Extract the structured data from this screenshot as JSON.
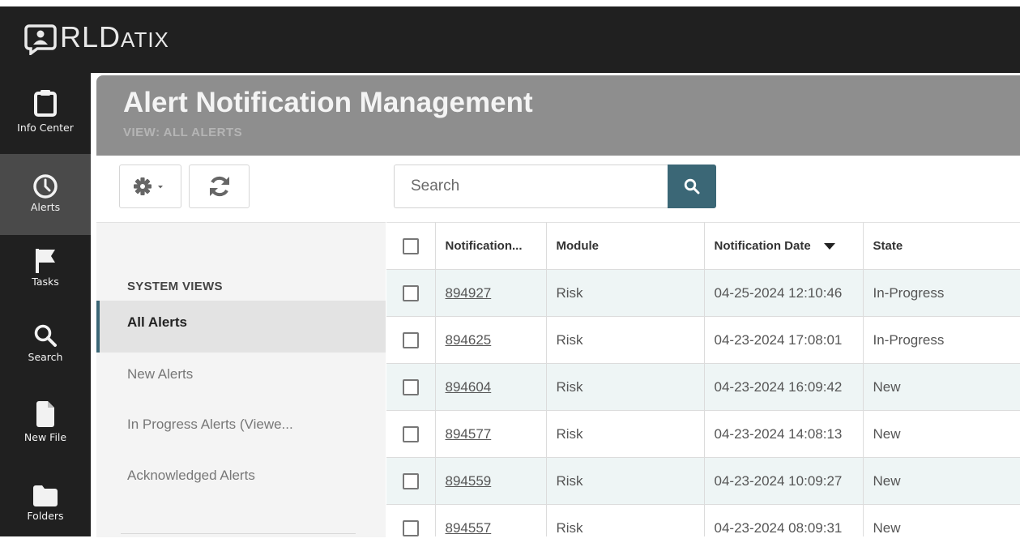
{
  "brand": {
    "logo_text_r": "R",
    "logo_text_l": "L",
    "logo_text_d": "D",
    "logo_text_rest": "ATIX",
    "logo_icon": "chat-person-icon"
  },
  "sidebar": {
    "items": [
      {
        "label": "Info Center",
        "icon": "clipboard-icon",
        "active": false
      },
      {
        "label": "Alerts",
        "icon": "clock-icon",
        "active": true
      },
      {
        "label": "Tasks",
        "icon": "flag-icon",
        "active": false
      },
      {
        "label": "Search",
        "icon": "search-icon",
        "active": false
      },
      {
        "label": "New File",
        "icon": "file-icon",
        "active": false
      },
      {
        "label": "Folders",
        "icon": "folder-icon",
        "active": false
      }
    ]
  },
  "header": {
    "title": "Alert Notification Management",
    "subtitle": "VIEW: ALL ALERTS"
  },
  "toolbar": {
    "settings_icon": "gear-dropdown-icon",
    "refresh_icon": "refresh-icon"
  },
  "search": {
    "placeholder": "Search",
    "value": "",
    "button_icon": "search-icon"
  },
  "views": {
    "heading": "SYSTEM VIEWS",
    "items": [
      {
        "label": "All Alerts",
        "selected": true
      },
      {
        "label": "New Alerts",
        "selected": false
      },
      {
        "label": "In Progress Alerts (Viewe...",
        "selected": false
      },
      {
        "label": "Acknowledged Alerts",
        "selected": false
      }
    ]
  },
  "table": {
    "columns": [
      "Notification...",
      "Module",
      "Notification Date",
      "State"
    ],
    "sorted_column": "Notification Date",
    "sort_direction": "descending",
    "rows": [
      {
        "id": "894927",
        "module": "Risk",
        "date": "04-25-2024 12:10:46",
        "state": "In-Progress"
      },
      {
        "id": "894625",
        "module": "Risk",
        "date": "04-23-2024 17:08:01",
        "state": "In-Progress"
      },
      {
        "id": "894604",
        "module": "Risk",
        "date": "04-23-2024 16:09:42",
        "state": "New"
      },
      {
        "id": "894577",
        "module": "Risk",
        "date": "04-23-2024 14:08:13",
        "state": "New"
      },
      {
        "id": "894559",
        "module": "Risk",
        "date": "04-23-2024 10:09:27",
        "state": "New"
      },
      {
        "id": "894557",
        "module": "Risk",
        "date": "04-23-2024 08:09:31",
        "state": "New"
      }
    ]
  },
  "colors": {
    "dark": "#202020",
    "accent": "#3b6776",
    "header_band": "#8e8e8e",
    "row_alt": "#eef5f5"
  }
}
